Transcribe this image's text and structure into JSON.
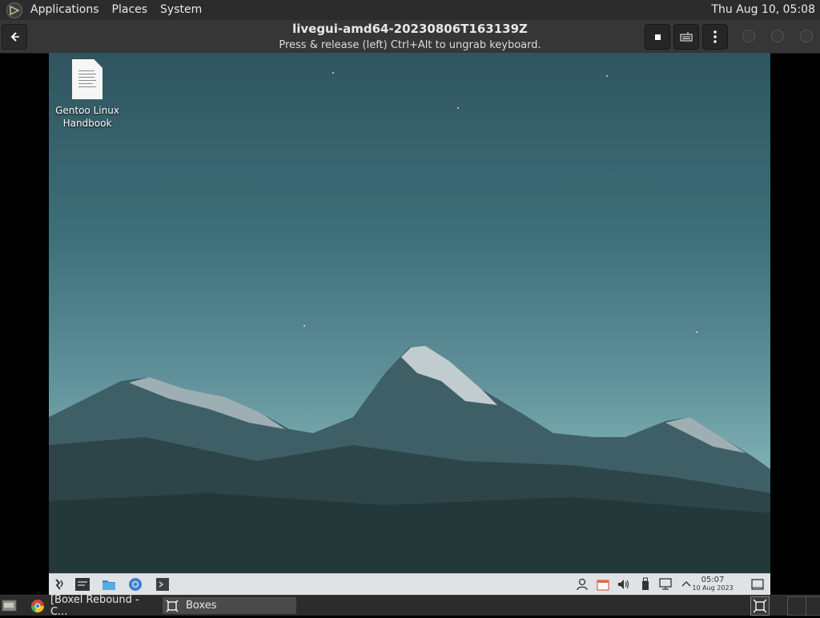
{
  "host_panel": {
    "menus": [
      "Applications",
      "Places",
      "System"
    ],
    "clock": "Thu Aug 10, 05:08"
  },
  "boxes": {
    "title": "livegui-amd64-20230806T163139Z",
    "subtitle": "Press & release (left) Ctrl+Alt to ungrab keyboard.",
    "buttons": [
      "back-icon",
      "stop-icon",
      "keyboard-icon",
      "menu-dots-icon"
    ]
  },
  "guest": {
    "desktop_icons": [
      {
        "label_line1": "Gentoo Linux",
        "label_line2": "Handbook",
        "icon": "document-icon"
      }
    ],
    "taskbar": {
      "clock_time": "05:07",
      "clock_date": "10 Aug 2023",
      "launchers": [
        "app-menu-icon",
        "terminal-icon",
        "file-manager-icon",
        "browser-icon",
        "console-icon"
      ],
      "tray": [
        "user-icon",
        "calendar-icon",
        "volume-icon",
        "usb-icon",
        "network-icon",
        "chevron-up-icon",
        "show-desktop-icon"
      ]
    }
  },
  "host_bottom": {
    "tasks": [
      {
        "label": "[Boxel Rebound - C...",
        "icon": "chrome-icon"
      },
      {
        "label": "Boxes",
        "icon": "boxes-icon"
      }
    ]
  },
  "colors": {
    "panel": "#2c2c2c",
    "sky_top": "#2f5560",
    "sky_bottom": "#8cbcbd",
    "taskbar": "#dfe3e6"
  }
}
